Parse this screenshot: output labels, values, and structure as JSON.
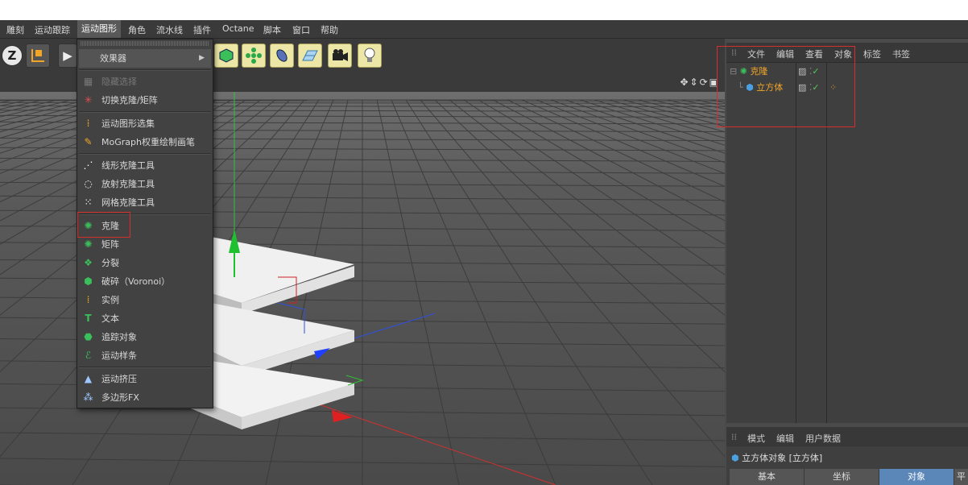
{
  "menubar": {
    "items": [
      "雕刻",
      "运动跟踪",
      "运动图形",
      "角色",
      "流水线",
      "插件",
      "Octane",
      "脚本",
      "窗口",
      "帮助"
    ],
    "active_index": 2
  },
  "dropdown": {
    "effector_label": "效果器",
    "hide_selection": "隐藏选择",
    "toggle_clone_matrix": "切换克隆/矩阵",
    "mograph_selection": "运动图形选集",
    "mograph_weight_brush": "MoGraph权重绘制画笔",
    "linear_clone_tool": "线形克隆工具",
    "radial_clone_tool": "放射克隆工具",
    "grid_clone_tool": "网格克隆工具",
    "cloner": "克隆",
    "matrix": "矩阵",
    "fracture": "分裂",
    "voronoi_fracture": "破碎（Voronoi）",
    "instance": "实例",
    "text": "文本",
    "tracer": "追踪对象",
    "mospline": "运动样条",
    "moextrude": "运动挤压",
    "polyfx": "多边形FX"
  },
  "object_manager": {
    "menu": [
      "文件",
      "编辑",
      "查看",
      "对象",
      "标签",
      "书签"
    ],
    "objects": [
      {
        "name": "克隆",
        "level": 0
      },
      {
        "name": "立方体",
        "level": 1
      }
    ]
  },
  "attributes": {
    "menu": [
      "模式",
      "编辑",
      "用户数据"
    ],
    "object_title": "立方体对象 [立方体]",
    "tabs": [
      "基本",
      "坐标",
      "对象",
      "平"
    ],
    "selected_tab": 2
  },
  "colors": {
    "accent_orange": "#f2a628",
    "highlight_red": "#d62d2d",
    "tab_selected": "#5a86b8",
    "toolbar_icon_bg": "#ece7a6"
  }
}
